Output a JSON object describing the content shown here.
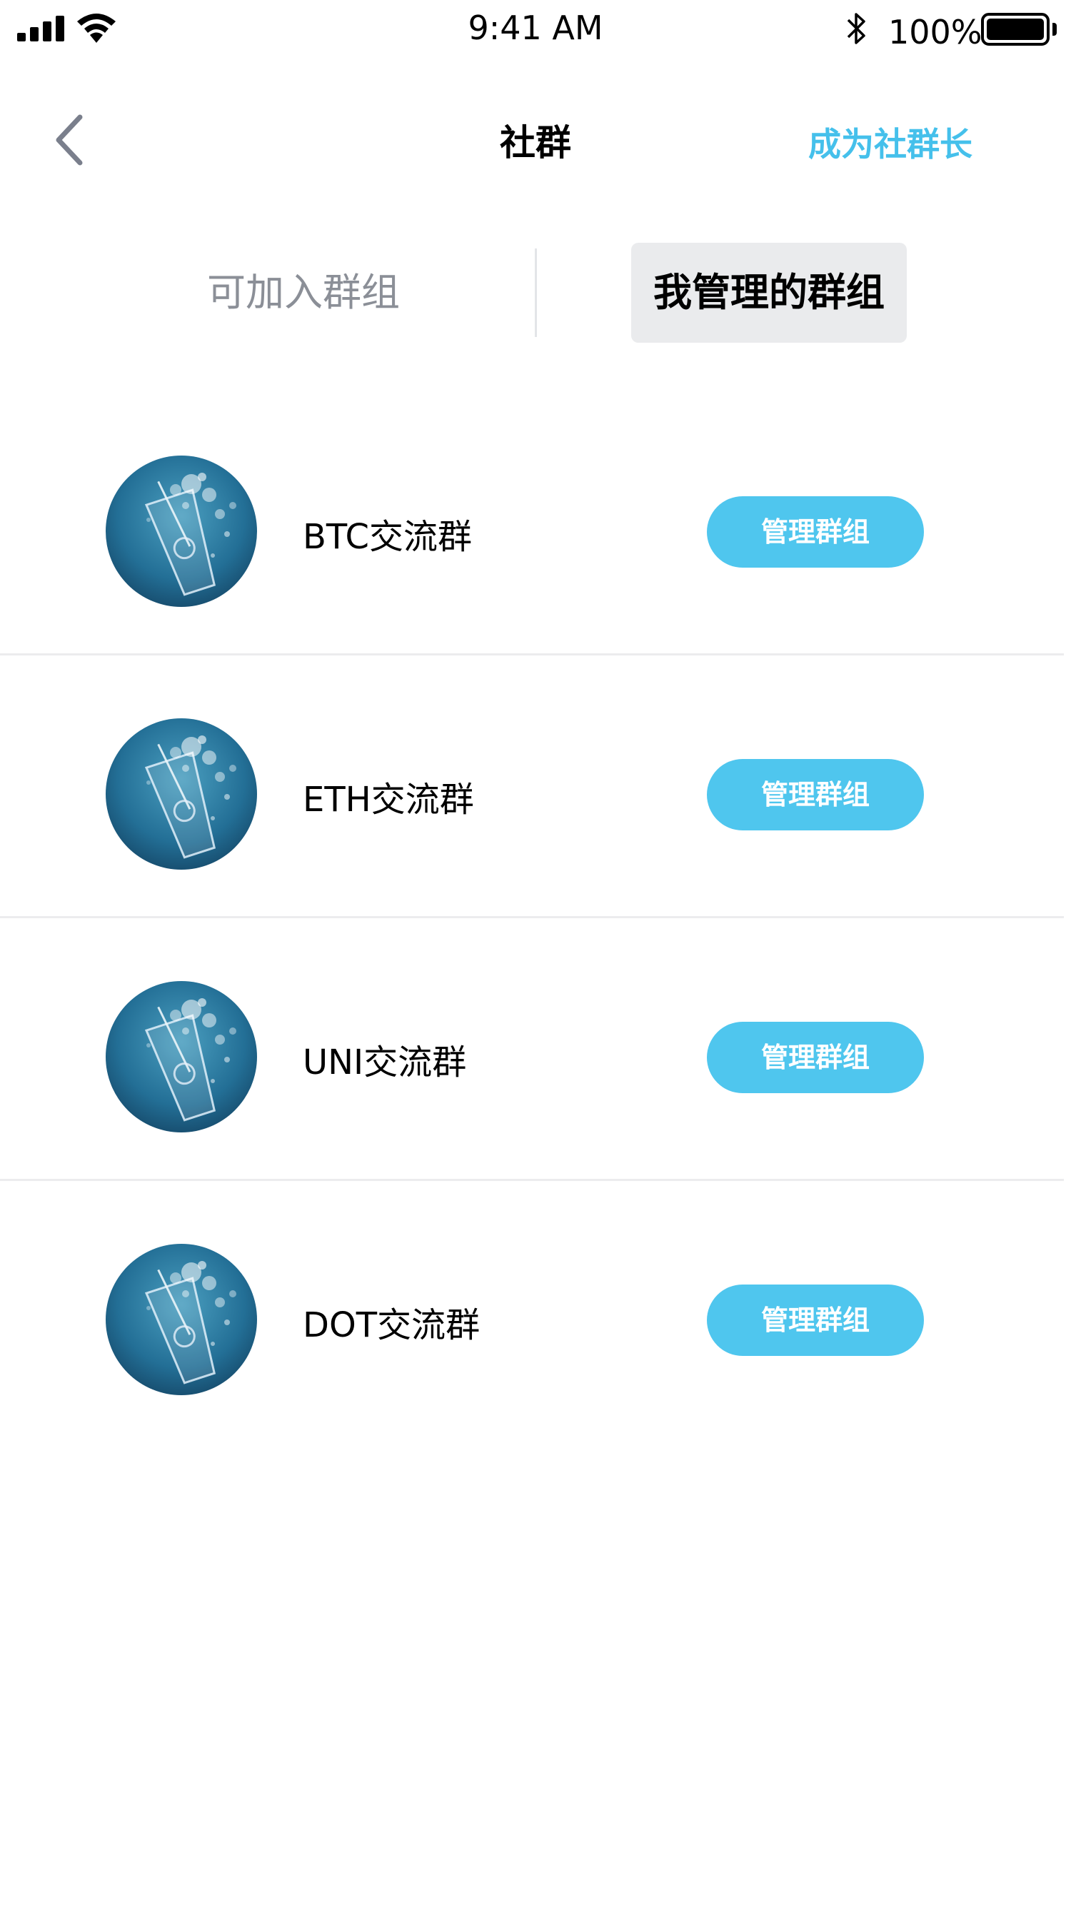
{
  "status_bar": {
    "time": "9:41 AM",
    "battery_percent": "100%"
  },
  "nav": {
    "title": "社群",
    "action_label": "成为社群长"
  },
  "tabs": [
    {
      "label": "可加入群组",
      "selected": false
    },
    {
      "label": "我管理的群组",
      "selected": true
    }
  ],
  "groups": [
    {
      "name": "BTC交流群",
      "button_label": "管理群组"
    },
    {
      "name": "ETH交流群",
      "button_label": "管理群组"
    },
    {
      "name": "UNI交流群",
      "button_label": "管理群组"
    },
    {
      "name": "DOT交流群",
      "button_label": "管理群组"
    }
  ],
  "colors": {
    "accent": "#45c0eb",
    "button_bg": "#4fc6ee",
    "tab_selected_bg": "#eaebed",
    "tab_inactive_text": "#8b8f97"
  }
}
